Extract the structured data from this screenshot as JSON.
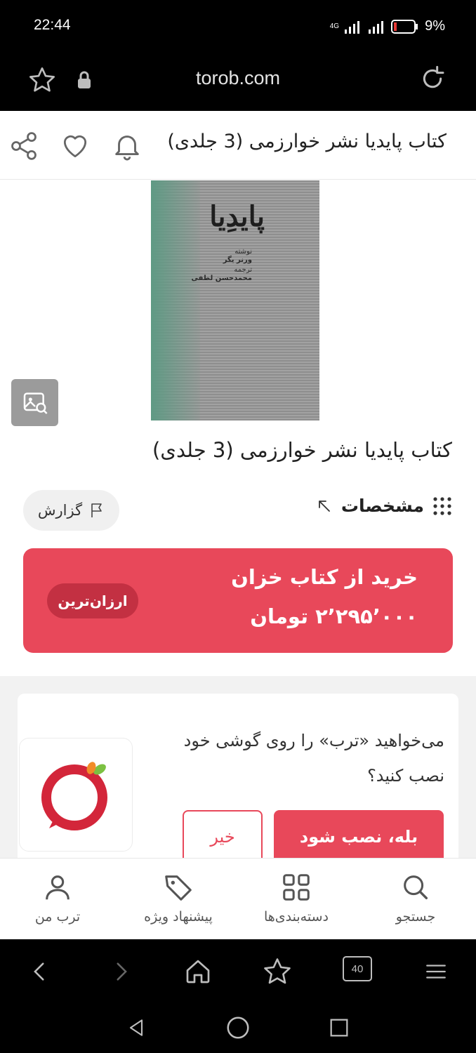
{
  "status_bar": {
    "time": "22:44",
    "battery": "9%",
    "network": "4G"
  },
  "browser": {
    "url": "torob.com"
  },
  "header": {
    "title": "کتاب پایدیا نشر خوارزمی (3 جلدی)"
  },
  "book_cover": {
    "title": "پایدِیا",
    "line1": "نوشته",
    "line2": "ورنر یگر",
    "line3": "ترجمه",
    "line4": "محمدحسن لطفی"
  },
  "product": {
    "title": "کتاب پایدیا نشر خوارزمی (3 جلدی)"
  },
  "specs": {
    "label": "مشخصات"
  },
  "report": {
    "label": "گزارش"
  },
  "buy": {
    "store": "خرید از کتاب خزان",
    "price": "۲٬۲۹۵٬۰۰۰ تومان",
    "badge": "ارزان‌ترین"
  },
  "install": {
    "message": "می‌خواهید «ترب» را روی گوشی خود نصب کنید؟",
    "yes_label": "بله، نصب شود",
    "no_label": "خیر"
  },
  "bottom_nav": {
    "search": "جستجو",
    "categories": "دسته‌بندی‌ها",
    "offers": "پیشنهاد ویژه",
    "my_torob": "ترب من"
  },
  "browser_tools": {
    "tabs_count": "40"
  },
  "colors": {
    "accent": "#e8485a",
    "badge": "#c33042"
  }
}
